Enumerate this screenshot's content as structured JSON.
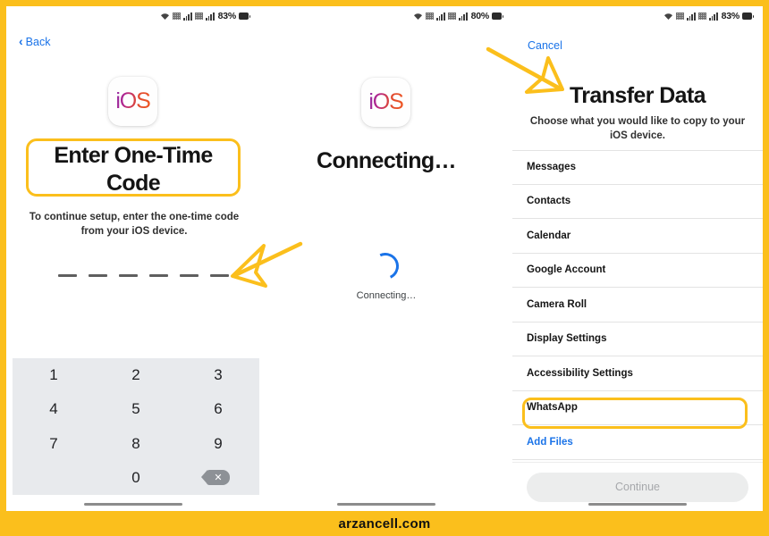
{
  "watermark": {
    "text": "arzancell.com"
  },
  "theme": {
    "accent_yellow": "#FBBF1C",
    "link_blue": "#1a73e8",
    "keypad_bg": "#e8eaed"
  },
  "panels": {
    "left": {
      "status": {
        "battery": "83%",
        "wifi_icon": "wifi-icon",
        "signal_icon": "signal-bars-icon",
        "battery_icon": "battery-icon"
      },
      "back_label": "Back",
      "app_icon_text": "iOS",
      "title": "Enter One-Time Code",
      "subtitle": "To continue setup, enter the one-time code from your iOS device.",
      "otp_slots": 6,
      "keypad": [
        "1",
        "2",
        "3",
        "4",
        "5",
        "6",
        "7",
        "8",
        "9",
        "",
        "0",
        "delete"
      ]
    },
    "middle": {
      "status": {
        "battery": "80%"
      },
      "app_icon_text": "iOS",
      "title": "Connecting…",
      "spinner_label": "Connecting…"
    },
    "right": {
      "status": {
        "battery": "83%"
      },
      "cancel_label": "Cancel",
      "title": "Transfer Data",
      "subtitle": "Choose what you would like to copy to your iOS device.",
      "items": [
        {
          "label": "Messages",
          "type": "item"
        },
        {
          "label": "Contacts",
          "type": "item"
        },
        {
          "label": "Calendar",
          "type": "item"
        },
        {
          "label": "Google Account",
          "type": "item"
        },
        {
          "label": "Camera Roll",
          "type": "item"
        },
        {
          "label": "Display Settings",
          "type": "item"
        },
        {
          "label": "Accessibility Settings",
          "type": "item"
        },
        {
          "label": "WhatsApp",
          "type": "item",
          "highlighted": true
        },
        {
          "label": "Add Files",
          "type": "link"
        }
      ],
      "continue_label": "Continue",
      "continue_enabled": false
    }
  }
}
